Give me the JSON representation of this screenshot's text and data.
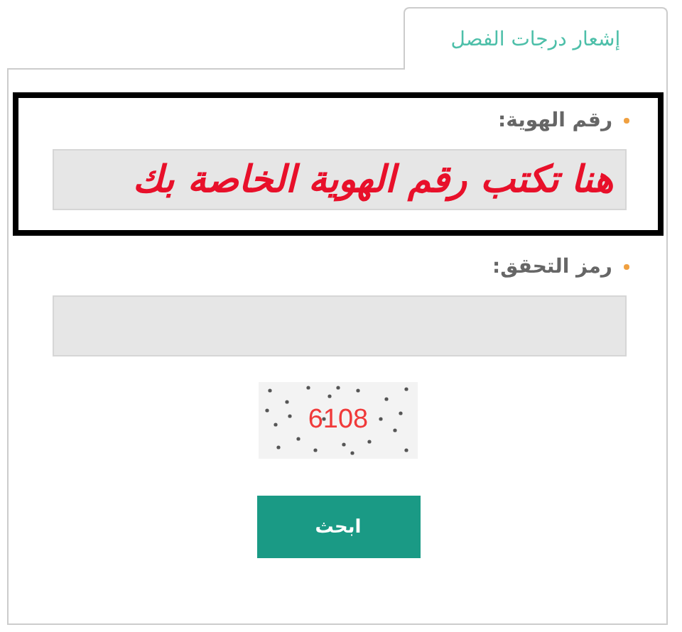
{
  "tabs": [
    {
      "label": "إشعار درجات الفصل",
      "selected": true
    }
  ],
  "fields": [
    {
      "label": "رقم الهوية:",
      "required": true,
      "value": "هنا تكتب رقم الهوية الخاصة بك",
      "highlighted": true
    },
    {
      "label": "رمز التحقق:",
      "required": true,
      "highlighted": false
    }
  ],
  "captcha": {
    "code": "6108"
  },
  "buttons": [
    "ابحث"
  ]
}
